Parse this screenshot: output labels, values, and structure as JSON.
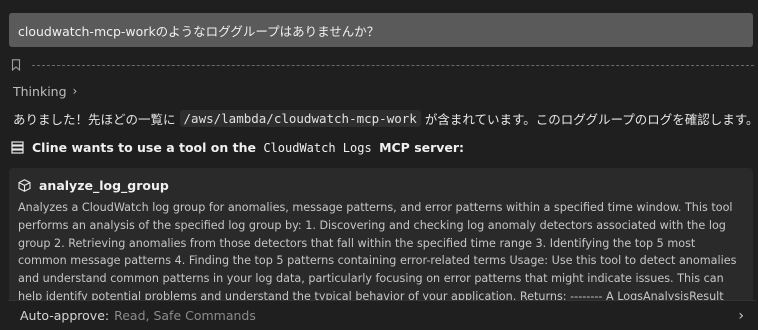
{
  "user_message": "cloudwatch-mcp-workのようなロググループはありませんか？",
  "thinking": {
    "label": "Thinking",
    "chevron": "›"
  },
  "reply": {
    "before": "ありました！先ほどの一覧に",
    "code": "/aws/lambda/cloudwatch-mcp-work",
    "after": "が含まれています。このロググループのログを確認します。"
  },
  "tool_request": {
    "prefix": "Cline wants to use a tool on the",
    "server_name": "CloudWatch Logs",
    "suffix": "MCP server:"
  },
  "tool": {
    "name": "analyze_log_group",
    "description": "Analyzes a CloudWatch log group for anomalies, message patterns, and error patterns within a specified time window. This tool performs an analysis of the specified log group by: 1. Discovering and checking log anomaly detectors associated with the log group 2. Retrieving anomalies from those detectors that fall within the specified time range 3. Identifying the top 5 most common message patterns 4. Finding the top 5 patterns containing error-related terms Usage: Use this tool to detect anomalies and understand common patterns in your log data, particularly focusing on error patterns that might indicate issues. This can help identify potential problems and understand the typical behavior of your application. Returns: -------- A LogsAnalysisResult object containing: - log_anomaly_results: Information"
  },
  "auto_approve": {
    "label": "Auto-approve:",
    "value": "Read, Safe Commands",
    "chevron": "›"
  },
  "icons": {
    "bookmark": "bookmark-icon",
    "server": "server-icon",
    "cube": "cube-icon"
  }
}
